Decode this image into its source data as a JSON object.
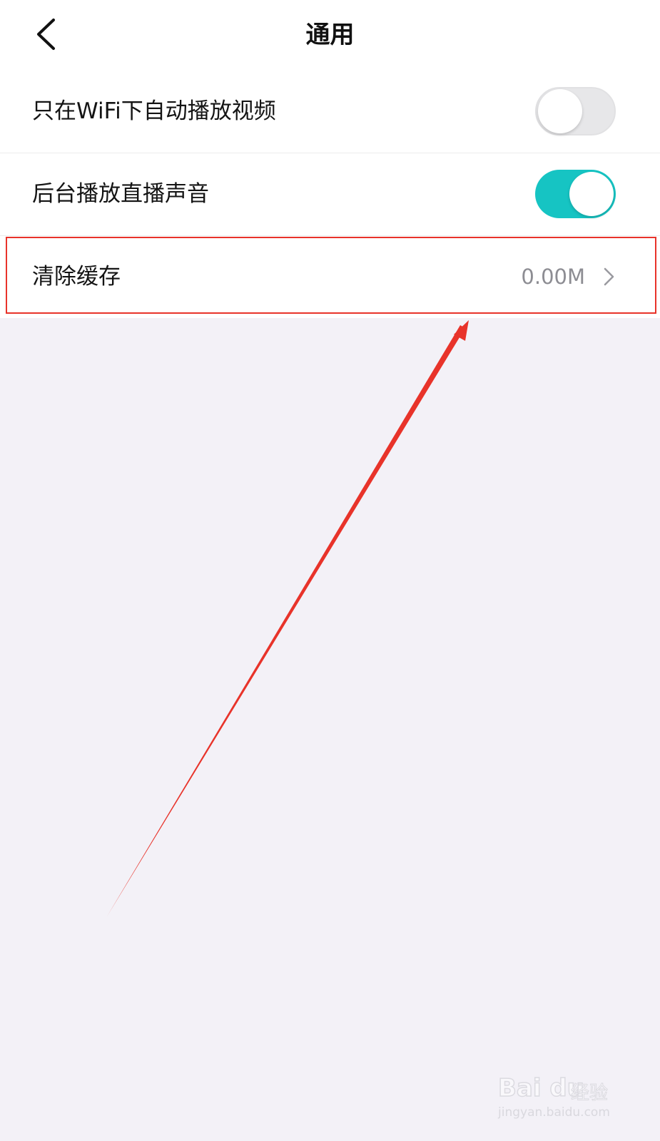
{
  "header": {
    "title": "通用"
  },
  "settings": [
    {
      "label": "只在WiFi下自动播放视频",
      "toggle_on": false
    },
    {
      "label": "后台播放直播声音",
      "toggle_on": true
    },
    {
      "label": "清除缓存",
      "value": "0.00M"
    }
  ],
  "watermark": {
    "brand": "Bai du",
    "sub": "经验",
    "url": "jingyan.baidu.com"
  },
  "colors": {
    "accent": "#16c4c3",
    "annotation": "#e8332a",
    "background": "#f3f1f7"
  }
}
